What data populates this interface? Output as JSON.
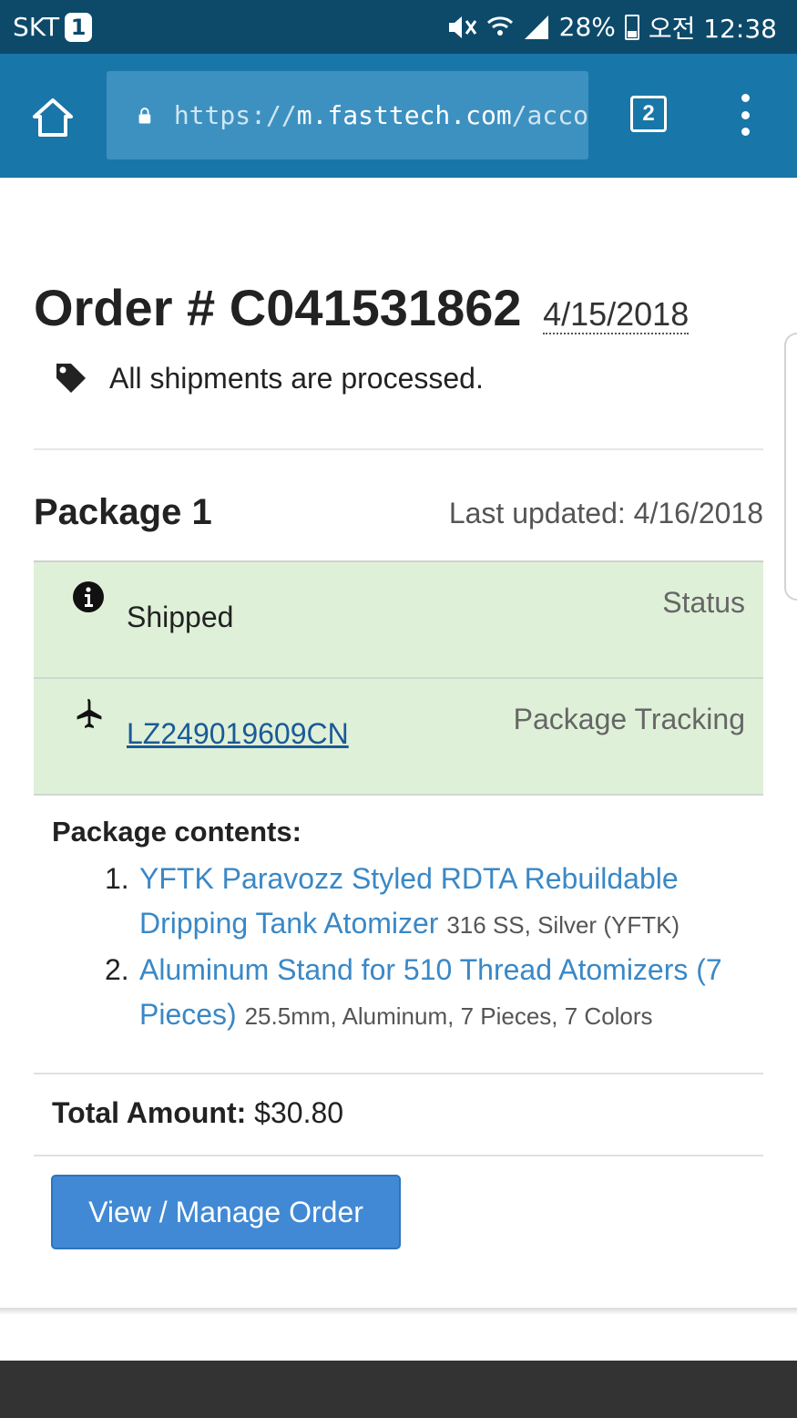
{
  "status_bar": {
    "carrier": "SKT",
    "carrier_badge": "1",
    "battery": "28%",
    "time": "오전 12:38"
  },
  "browser": {
    "url_scheme": "https://",
    "url_host": "m.fasttech.com",
    "url_path": "/acco",
    "tab_count": "2"
  },
  "order": {
    "title": "Order # C041531862",
    "date": "4/15/2018",
    "processed_text": "All shipments are processed."
  },
  "package": {
    "title": "Package 1",
    "last_updated": "Last updated: 4/16/2018",
    "status_value": "Shipped",
    "status_label": "Status",
    "tracking_value": "LZ249019609CN",
    "tracking_label": "Package Tracking",
    "contents_title": "Package contents:",
    "items": [
      {
        "num": "1.",
        "name": "YFTK Paravozz Styled RDTA Rebuildable Dripping Tank Atomizer",
        "options": "316 SS, Silver (YFTK)"
      },
      {
        "num": "2.",
        "name": "Aluminum Stand for 510 Thread Atomizers (7 Pieces)",
        "options": "25.5mm, Aluminum, 7 Pieces, 7 Colors"
      }
    ]
  },
  "total": {
    "label": "Total Amount:",
    "value": "$30.80"
  },
  "actions": {
    "manage_label": "View / Manage Order"
  },
  "colors": {
    "status_bar": "#0d4a6a",
    "toolbar": "#1976a8",
    "success_bg": "#dff0d8",
    "link": "#3a88c6",
    "button": "#4189d4"
  }
}
